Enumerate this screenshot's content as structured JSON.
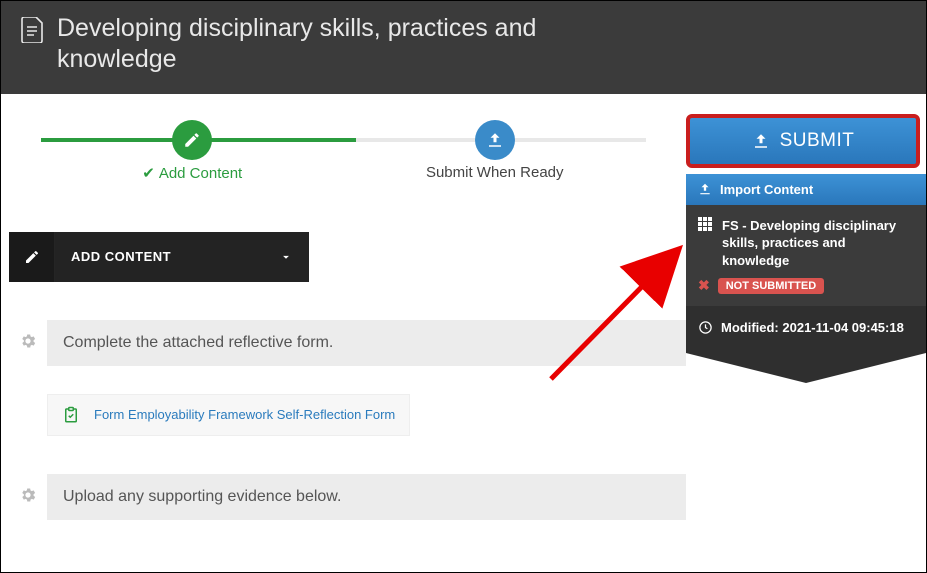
{
  "header": {
    "title": "Developing disciplinary skills, practices and knowledge"
  },
  "progress": {
    "step1_label": "Add Content",
    "step2_label": "Submit When Ready"
  },
  "buttons": {
    "add_content": "ADD CONTENT",
    "submit": "SUBMIT",
    "import_content": "Import Content"
  },
  "sections": {
    "reflective_prompt": "Complete the attached reflective form.",
    "upload_prompt": "Upload any supporting evidence below."
  },
  "form_link": {
    "label": "Form Employability Framework Self-Reflection Form"
  },
  "sidebar": {
    "course_title": "FS - Developing disciplinary skills, practices and knowledge",
    "status_badge": "NOT SUBMITTED",
    "modified_label": "Modified:",
    "modified_value": "2021-11-04 09:45:18"
  }
}
